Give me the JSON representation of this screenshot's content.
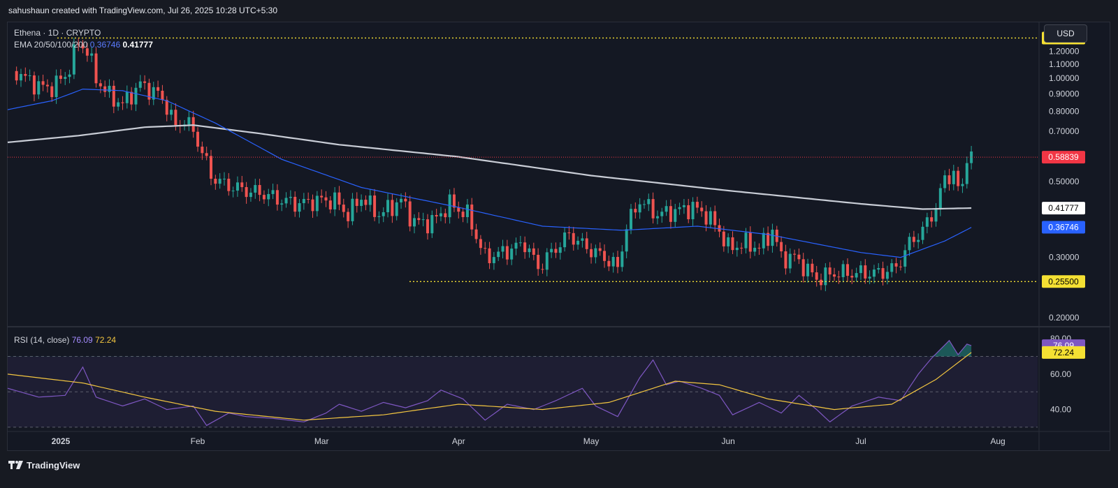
{
  "header": {
    "attribution": "sahushaun created with TradingView.com, Jul 26, 2025 10:28 UTC+5:30"
  },
  "legend": {
    "symbol_line": "Ethena · 1D · CRYPTO",
    "ema_label": "EMA 20/50/100/200",
    "ema_blue_value": "0.36746",
    "ema_white_value": "0.41777",
    "rsi_label": "RSI (14, close)",
    "rsi_value": "76.09",
    "rsi_ma_value": "72.24"
  },
  "currency_button": "USD",
  "footer": {
    "brand": "TradingView"
  },
  "colors": {
    "background": "#141823",
    "candle_up": "#26a69a",
    "candle_down": "#ef5350",
    "ema_blue": "#2962ff",
    "ema_white": "#c9cdd6",
    "rsi_line": "#7e57c2",
    "rsi_ma": "#f3c640",
    "price_tag": "#f23645",
    "level_tag": "#f5e033"
  },
  "chart_data": [
    {
      "type": "candlestick",
      "title": "Ethena · 1D · CRYPTO",
      "x_tick_labels": [
        "2025",
        "Feb",
        "Mar",
        "Apr",
        "May",
        "Jun",
        "Jul",
        "Aug"
      ],
      "y_tick_labels": [
        "1.20000",
        "1.10000",
        "1.00000",
        "0.90000",
        "0.80000",
        "0.70000",
        "0.50000",
        "0.30000",
        "0.20000"
      ],
      "scale": "log",
      "ylim": [
        0.19,
        1.45
      ],
      "x_range": [
        "2024-12-20",
        "2025-08-10"
      ],
      "levels": [
        {
          "value": 1.3111,
          "label": "1.31110",
          "style": "dotted",
          "color": "#f5e033"
        },
        {
          "value": 0.255,
          "label": "0.25500",
          "style": "dotted",
          "color": "#f5e033"
        }
      ],
      "current_price": {
        "value": 0.58839,
        "label": "0.58839"
      },
      "ema_tags": [
        {
          "value": 0.41777,
          "label": "0.41777"
        },
        {
          "value": 0.36746,
          "label": "0.36746"
        }
      ],
      "anchors": [
        [
          "2024-12-22",
          1.05
        ],
        [
          "2024-12-25",
          0.98
        ],
        [
          "2024-12-29",
          0.93
        ],
        [
          "2025-01-02",
          1.01
        ],
        [
          "2025-01-05",
          1.27
        ],
        [
          "2025-01-07",
          1.21
        ],
        [
          "2025-01-09",
          1.0
        ],
        [
          "2025-01-12",
          0.89
        ],
        [
          "2025-01-15",
          0.84
        ],
        [
          "2025-01-19",
          0.96
        ],
        [
          "2025-01-23",
          0.9
        ],
        [
          "2025-01-25",
          0.83
        ],
        [
          "2025-01-27",
          0.72
        ],
        [
          "2025-01-29",
          0.76
        ],
        [
          "2025-01-31",
          0.7
        ],
        [
          "2025-02-02",
          0.61
        ],
        [
          "2025-02-04",
          0.52
        ],
        [
          "2025-02-07",
          0.49
        ],
        [
          "2025-02-12",
          0.47
        ],
        [
          "2025-02-16",
          0.46
        ],
        [
          "2025-02-20",
          0.44
        ],
        [
          "2025-02-24",
          0.43
        ],
        [
          "2025-02-28",
          0.44
        ],
        [
          "2025-03-04",
          0.44
        ],
        [
          "2025-03-07",
          0.4
        ],
        [
          "2025-03-10",
          0.45
        ],
        [
          "2025-03-14",
          0.4
        ],
        [
          "2025-03-19",
          0.44
        ],
        [
          "2025-03-22",
          0.38
        ],
        [
          "2025-03-26",
          0.38
        ],
        [
          "2025-03-30",
          0.43
        ],
        [
          "2025-04-03",
          0.4
        ],
        [
          "2025-04-07",
          0.3
        ],
        [
          "2025-04-11",
          0.31
        ],
        [
          "2025-04-16",
          0.33
        ],
        [
          "2025-04-19",
          0.28
        ],
        [
          "2025-04-22",
          0.31
        ],
        [
          "2025-04-26",
          0.35
        ],
        [
          "2025-04-30",
          0.32
        ],
        [
          "2025-05-04",
          0.3
        ],
        [
          "2025-05-07",
          0.28
        ],
        [
          "2025-05-09",
          0.37
        ],
        [
          "2025-05-12",
          0.44
        ],
        [
          "2025-05-16",
          0.4
        ],
        [
          "2025-05-20",
          0.41
        ],
        [
          "2025-05-24",
          0.42
        ],
        [
          "2025-05-27",
          0.4
        ],
        [
          "2025-05-30",
          0.36
        ],
        [
          "2025-06-01",
          0.32
        ],
        [
          "2025-06-05",
          0.33
        ],
        [
          "2025-06-08",
          0.32
        ],
        [
          "2025-06-11",
          0.36
        ],
        [
          "2025-06-13",
          0.3
        ],
        [
          "2025-06-16",
          0.3
        ],
        [
          "2025-06-21",
          0.26
        ],
        [
          "2025-06-25",
          0.27
        ],
        [
          "2025-06-30",
          0.27
        ],
        [
          "2025-07-05",
          0.27
        ],
        [
          "2025-07-09",
          0.28
        ],
        [
          "2025-07-12",
          0.33
        ],
        [
          "2025-07-15",
          0.36
        ],
        [
          "2025-07-18",
          0.42
        ],
        [
          "2025-07-20",
          0.51
        ],
        [
          "2025-07-22",
          0.53
        ],
        [
          "2025-07-23",
          0.47
        ],
        [
          "2025-07-24",
          0.49
        ],
        [
          "2025-07-25",
          0.6
        ],
        [
          "2025-07-26",
          0.588
        ]
      ],
      "ema_blue": [
        [
          "2024-12-20",
          0.81
        ],
        [
          "2024-12-30",
          0.86
        ],
        [
          "2025-01-06",
          0.93
        ],
        [
          "2025-01-15",
          0.92
        ],
        [
          "2025-01-25",
          0.86
        ],
        [
          "2025-02-05",
          0.74
        ],
        [
          "2025-02-20",
          0.58
        ],
        [
          "2025-03-10",
          0.48
        ],
        [
          "2025-04-01",
          0.42
        ],
        [
          "2025-04-20",
          0.37
        ],
        [
          "2025-05-08",
          0.36
        ],
        [
          "2025-05-25",
          0.37
        ],
        [
          "2025-06-10",
          0.35
        ],
        [
          "2025-07-01",
          0.31
        ],
        [
          "2025-07-10",
          0.3
        ],
        [
          "2025-07-20",
          0.335
        ],
        [
          "2025-07-26",
          0.367
        ]
      ],
      "ema_white": [
        [
          "2024-12-20",
          0.65
        ],
        [
          "2025-01-05",
          0.68
        ],
        [
          "2025-01-20",
          0.72
        ],
        [
          "2025-01-31",
          0.73
        ],
        [
          "2025-02-15",
          0.69
        ],
        [
          "2025-03-05",
          0.64
        ],
        [
          "2025-04-01",
          0.59
        ],
        [
          "2025-05-01",
          0.52
        ],
        [
          "2025-06-01",
          0.47
        ],
        [
          "2025-07-01",
          0.43
        ],
        [
          "2025-07-15",
          0.415
        ],
        [
          "2025-07-26",
          0.418
        ]
      ]
    },
    {
      "type": "line",
      "title": "RSI (14, close)",
      "ylim": [
        28,
        86
      ],
      "y_tick_labels": [
        "80.00",
        "60.00",
        "40.00"
      ],
      "bands": [
        30,
        50,
        70
      ],
      "series": [
        {
          "name": "RSI",
          "values": [
            [
              "2024-12-20",
              52
            ],
            [
              "2024-12-27",
              47
            ],
            [
              "2025-01-02",
              48
            ],
            [
              "2025-01-06",
              64
            ],
            [
              "2025-01-09",
              47
            ],
            [
              "2025-01-15",
              42
            ],
            [
              "2025-01-20",
              46
            ],
            [
              "2025-01-25",
              40
            ],
            [
              "2025-01-31",
              42
            ],
            [
              "2025-02-03",
              31
            ],
            [
              "2025-02-08",
              38
            ],
            [
              "2025-02-12",
              36
            ],
            [
              "2025-02-18",
              35
            ],
            [
              "2025-02-25",
              33
            ],
            [
              "2025-03-02",
              38
            ],
            [
              "2025-03-05",
              43
            ],
            [
              "2025-03-10",
              39
            ],
            [
              "2025-03-15",
              44
            ],
            [
              "2025-03-20",
              41
            ],
            [
              "2025-03-25",
              45
            ],
            [
              "2025-03-28",
              51
            ],
            [
              "2025-04-02",
              46
            ],
            [
              "2025-04-07",
              34
            ],
            [
              "2025-04-12",
              43
            ],
            [
              "2025-04-18",
              40
            ],
            [
              "2025-04-23",
              45
            ],
            [
              "2025-04-29",
              52
            ],
            [
              "2025-05-02",
              42
            ],
            [
              "2025-05-07",
              36
            ],
            [
              "2025-05-12",
              58
            ],
            [
              "2025-05-15",
              68
            ],
            [
              "2025-05-18",
              54
            ],
            [
              "2025-05-21",
              56
            ],
            [
              "2025-05-26",
              52
            ],
            [
              "2025-05-30",
              48
            ],
            [
              "2025-06-02",
              37
            ],
            [
              "2025-06-08",
              44
            ],
            [
              "2025-06-13",
              38
            ],
            [
              "2025-06-17",
              48
            ],
            [
              "2025-06-21",
              40
            ],
            [
              "2025-06-24",
              33
            ],
            [
              "2025-06-29",
              42
            ],
            [
              "2025-07-05",
              47
            ],
            [
              "2025-07-10",
              45
            ],
            [
              "2025-07-14",
              60
            ],
            [
              "2025-07-17",
              69
            ],
            [
              "2025-07-21",
              79
            ],
            [
              "2025-07-23",
              71
            ],
            [
              "2025-07-25",
              77
            ],
            [
              "2025-07-26",
              76.09
            ]
          ]
        },
        {
          "name": "RSI-based MA",
          "values": [
            [
              "2024-12-20",
              60
            ],
            [
              "2025-01-06",
              55
            ],
            [
              "2025-01-20",
              47
            ],
            [
              "2025-02-05",
              39
            ],
            [
              "2025-02-25",
              34
            ],
            [
              "2025-03-15",
              37
            ],
            [
              "2025-04-01",
              43
            ],
            [
              "2025-04-20",
              40
            ],
            [
              "2025-05-05",
              44
            ],
            [
              "2025-05-20",
              56
            ],
            [
              "2025-05-30",
              54
            ],
            [
              "2025-06-10",
              46
            ],
            [
              "2025-06-25",
              40
            ],
            [
              "2025-07-08",
              43
            ],
            [
              "2025-07-18",
              57
            ],
            [
              "2025-07-26",
              72.24
            ]
          ]
        }
      ]
    }
  ]
}
